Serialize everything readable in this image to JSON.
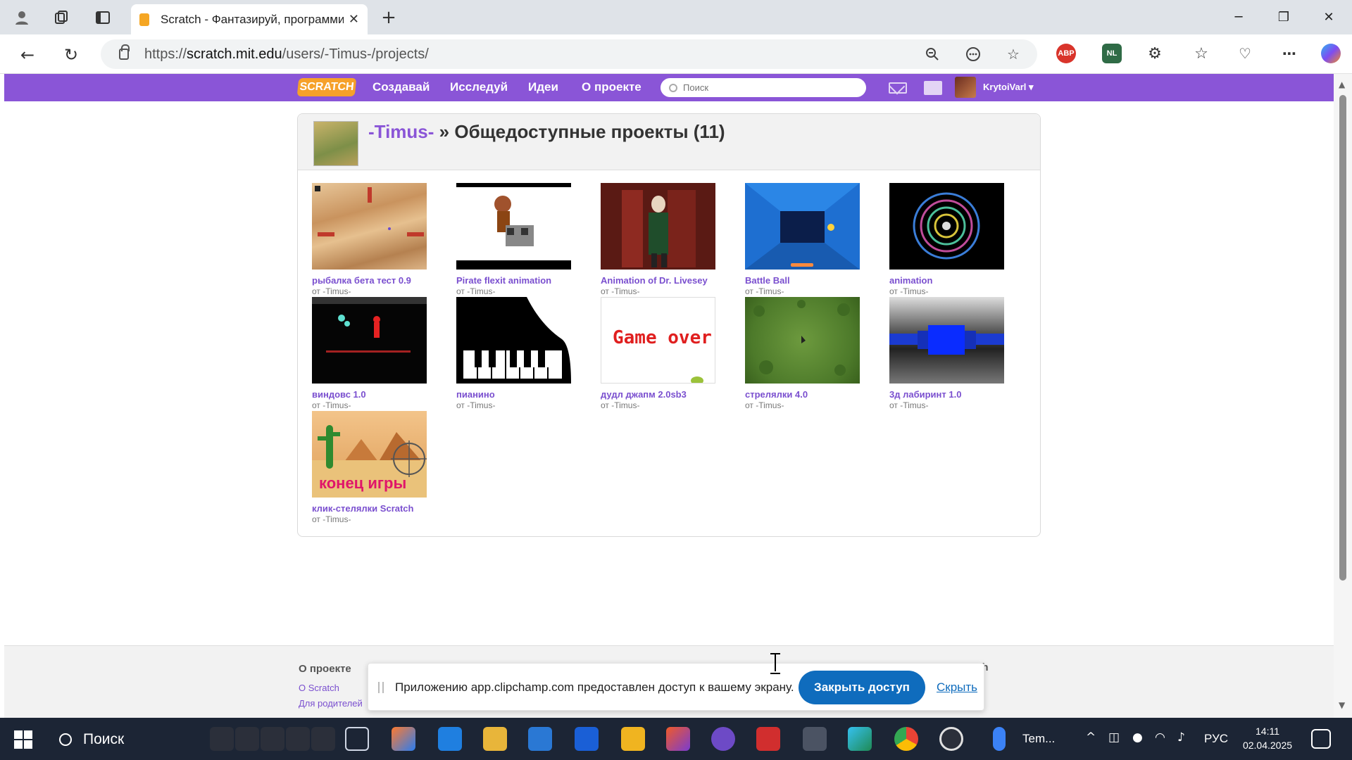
{
  "browser": {
    "tab_title": "Scratch - Фантазируй, программируй",
    "url_prefix": "https://",
    "url_host": "scratch.mit.edu",
    "url_path": "/users/-Timus-/projects/"
  },
  "scratch_nav": {
    "logo": "SCRATCH",
    "links": [
      "Создавай",
      "Исследуй",
      "Идеи",
      "О проекте"
    ],
    "search_placeholder": "Поиск",
    "username": "KrytoiVarl ▾"
  },
  "header": {
    "username": "-Timus-",
    "separator": " » ",
    "title": "Общедоступные проекты (11)"
  },
  "projects": [
    {
      "title": "рыбалка бета тест 0.9",
      "author": "от -Timus-"
    },
    {
      "title": "Pirate flexit animation",
      "author": "от -Timus-"
    },
    {
      "title": "Animation of Dr. Livesey",
      "author": "от -Timus-"
    },
    {
      "title": "Battle Ball",
      "author": "от -Timus-"
    },
    {
      "title": "animation",
      "author": "от -Timus-"
    },
    {
      "title": "виндовс 1.0",
      "author": "от -Timus-"
    },
    {
      "title": "пианино",
      "author": "от -Timus-"
    },
    {
      "title": "дудл джапм 2.0sb3",
      "author": "от -Timus-"
    },
    {
      "title": "стрелялки 4.0",
      "author": "от -Timus-"
    },
    {
      "title": "3д лабиринт 1.0",
      "author": "от -Timus-"
    },
    {
      "title": "клик-стелялки Scratch",
      "author": "от -Timus-"
    }
  ],
  "thumb_text": {
    "game_over": "Game over",
    "konec_igry": "конец игры"
  },
  "footer": {
    "heading": "О проекте",
    "links": [
      "О Scratch",
      "Для родителей"
    ],
    "cut_heading": "ch"
  },
  "share_bar": {
    "message": "Приложению app.clipchamp.com предоставлен доступ к вашему экрану.",
    "stop_button": "Закрыть доступ",
    "hide_link": "Скрыть"
  },
  "taskbar": {
    "search_label": "Поиск",
    "weather_text": "Tem...",
    "language": "РУС",
    "time": "14:11",
    "date": "02.04.2025"
  },
  "colors": {
    "scratch_purple": "#8a55d7",
    "link_purple": "#7a4fcf",
    "edge_blue": "#0f6cbd"
  }
}
